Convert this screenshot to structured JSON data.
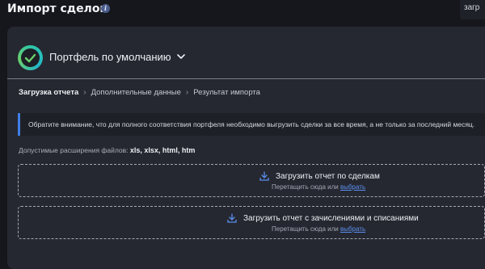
{
  "header": {
    "title": "Импорт сделок",
    "info_icon": "i",
    "corner_button": "загр"
  },
  "portfolio": {
    "logo": "check-logo",
    "name": "Портфель по умолчанию",
    "icon": "chevron-down-icon"
  },
  "steps": [
    {
      "label": "Загрузка отчета",
      "active": true
    },
    {
      "label": "Дополнительные данные",
      "active": false
    },
    {
      "label": "Результат импорта",
      "active": false
    }
  ],
  "notice": {
    "text": "Обратите внимание, что для полного соответствия портфеля необходимо выгрузить сделки за все время, а не только за последний месяц.",
    "accent_color": "#3f7ee8"
  },
  "extensions": {
    "label": "Допустимые расширения файлов:",
    "value": "xls, xlsx, html, htm"
  },
  "dropzones": [
    {
      "title": "Загрузить отчет по сделкам",
      "hint": "Перетащить сюда или",
      "link": "выбрать",
      "icon": "upload-icon"
    },
    {
      "title": "Загрузить отчет с зачислениями и списаниями",
      "hint": "Перетащить сюда или",
      "link": "выбрать",
      "icon": "upload-icon"
    }
  ]
}
